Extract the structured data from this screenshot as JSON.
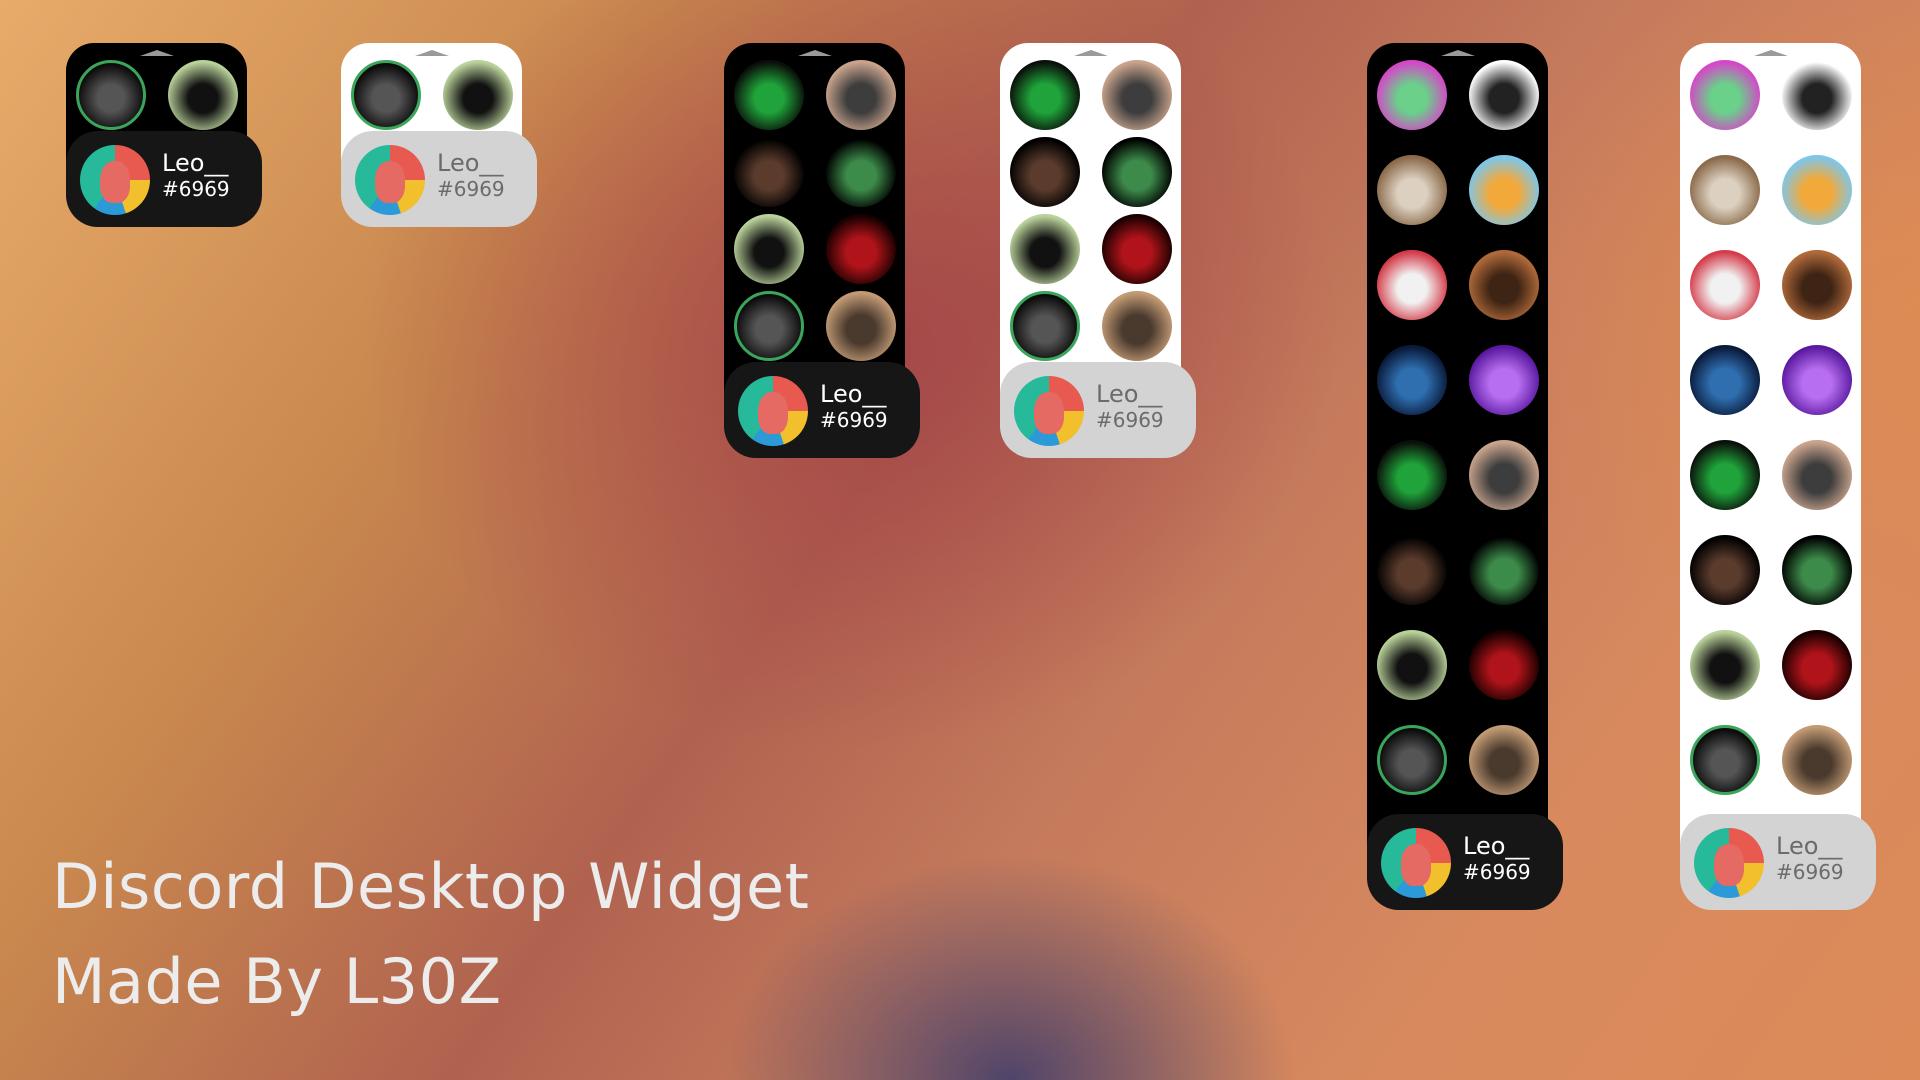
{
  "caption": {
    "line1": "Discord Desktop Widget",
    "line2": "Made By L30Z"
  },
  "user": {
    "name": "Leo__",
    "tag": "#6969"
  },
  "widgets": [
    {
      "theme": "dark",
      "size": "small"
    },
    {
      "theme": "light",
      "size": "small"
    },
    {
      "theme": "dark",
      "size": "medium"
    },
    {
      "theme": "light",
      "size": "medium"
    },
    {
      "theme": "dark",
      "size": "large"
    },
    {
      "theme": "light",
      "size": "large"
    }
  ],
  "friend_avatars": [
    {
      "icon": "green-dragon-avatar-icon",
      "colors": [
        "#0a0f0a",
        "#1fa33a"
      ],
      "online": false
    },
    {
      "icon": "bearded-man-avatar-icon",
      "colors": [
        "#c9a38c",
        "#3d3d3d"
      ],
      "online": false
    },
    {
      "icon": "anime-boy-avatar-icon",
      "colors": [
        "#000000",
        "#5a3b2c"
      ],
      "online": false
    },
    {
      "icon": "green-cross-avatar-icon",
      "colors": [
        "#000000",
        "#3d8b4a"
      ],
      "online": false
    },
    {
      "icon": "man-in-suit-avatar-icon",
      "colors": [
        "#b9d19a",
        "#111111"
      ],
      "online": false
    },
    {
      "icon": "red-dragon-avatar-icon",
      "colors": [
        "#1a0000",
        "#b0141a"
      ],
      "online": false
    },
    {
      "icon": "dark-knight-avatar-icon",
      "colors": [
        "#0c0c0c",
        "#555555"
      ],
      "online": true
    },
    {
      "icon": "sunglasses-man-avatar-icon",
      "colors": [
        "#c29a74",
        "#4a3a2e"
      ],
      "online": false
    },
    {
      "icon": "pink-character-avatar-icon",
      "colors": [
        "#d447c8",
        "#6ad08a"
      ],
      "online": false
    },
    {
      "icon": "anime-shouting-avatar-icon",
      "colors": [
        "#ffffff",
        "#222222"
      ],
      "online": false
    },
    {
      "icon": "dog-avatar-icon",
      "colors": [
        "#8a6a4a",
        "#dcd0c0"
      ],
      "online": false
    },
    {
      "icon": "ninja-anime-avatar-icon",
      "colors": [
        "#7fc6e8",
        "#f2a93a"
      ],
      "online": false
    },
    {
      "icon": "red-anime-avatar-icon",
      "colors": [
        "#d43c4a",
        "#f1f1f1"
      ],
      "online": false
    },
    {
      "icon": "close-up-face-avatar-icon",
      "colors": [
        "#b06a3a",
        "#3e2414"
      ],
      "online": false
    },
    {
      "icon": "blue-tree-avatar-icon",
      "colors": [
        "#0a1a3a",
        "#2f6fb0"
      ],
      "online": false
    },
    {
      "icon": "purple-skeleton-avatar-icon",
      "colors": [
        "#5a1aa0",
        "#b86ef0"
      ],
      "online": false
    }
  ]
}
